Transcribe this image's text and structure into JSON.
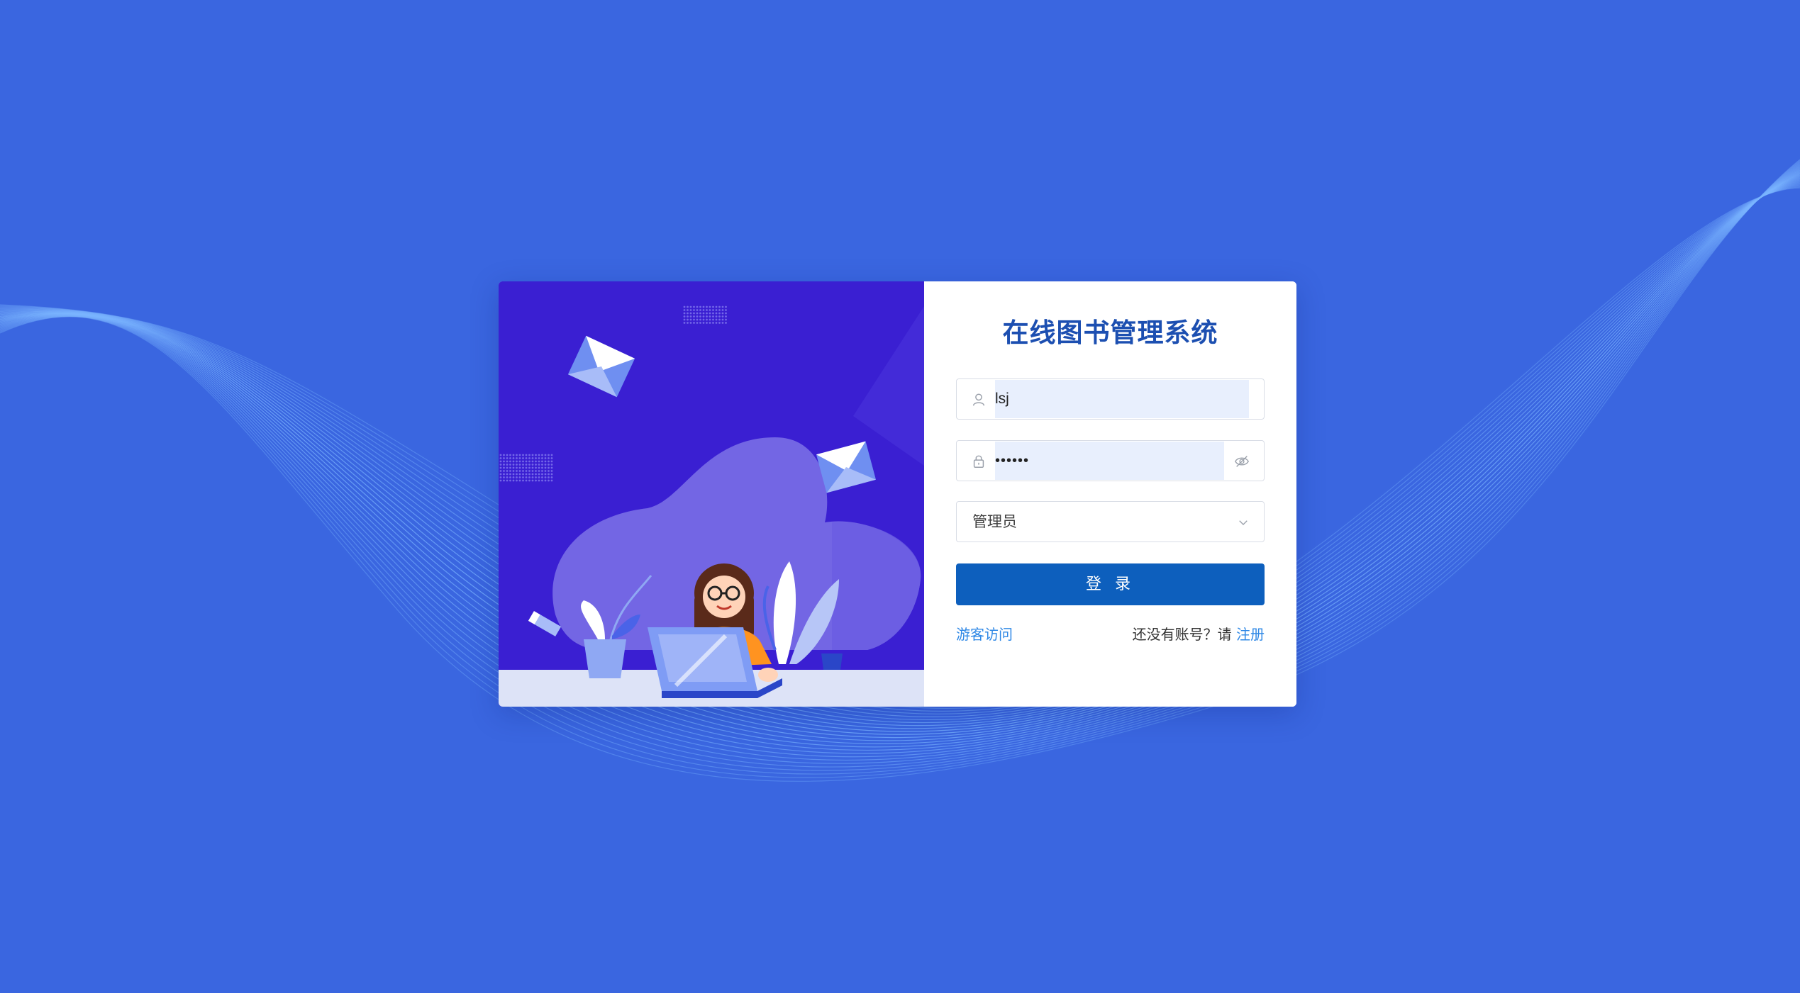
{
  "app": {
    "title": "在线图书管理系统"
  },
  "form": {
    "username_value": "lsj",
    "password_value": "••••••",
    "role_selected": "管理员",
    "login_label": "登 录",
    "guest_label": "游客访问",
    "register_prompt": "还没有账号？请 ",
    "register_label": "注册"
  },
  "icons": {
    "username": "user-icon",
    "password": "lock-icon",
    "toggle_password": "eye-off-icon",
    "select": "chevron-down-icon"
  },
  "colors": {
    "background": "#3a66e0",
    "title": "#1c4fb1",
    "primary_button": "#0d5fbd",
    "link": "#2f88e6",
    "input_fill": "#e8effd"
  }
}
